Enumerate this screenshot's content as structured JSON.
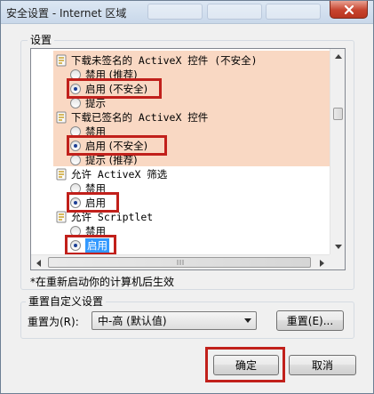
{
  "window": {
    "title": "安全设置 - Internet 区域"
  },
  "settings": {
    "group_label": "设置",
    "items": [
      {
        "kind": "header",
        "label": "下载未签名的 ActiveX 控件 (不安全)"
      },
      {
        "kind": "option",
        "label": "禁用 (推荐)",
        "selected": false
      },
      {
        "kind": "option",
        "label": "启用 (不安全)",
        "selected": true
      },
      {
        "kind": "option",
        "label": "提示",
        "selected": false
      },
      {
        "kind": "header",
        "label": "下载已签名的 ActiveX 控件"
      },
      {
        "kind": "option",
        "label": "禁用",
        "selected": false
      },
      {
        "kind": "option",
        "label": "启用 (不安全)",
        "selected": true
      },
      {
        "kind": "option",
        "label": "提示 (推荐)",
        "selected": false
      },
      {
        "kind": "header",
        "label": "允许 ActiveX 筛选"
      },
      {
        "kind": "option",
        "label": "禁用",
        "selected": false
      },
      {
        "kind": "option",
        "label": "启用",
        "selected": true
      },
      {
        "kind": "header",
        "label": "允许 Scriptlet"
      },
      {
        "kind": "option",
        "label": "禁用",
        "selected": false
      },
      {
        "kind": "option",
        "label": "启用",
        "selected": true
      }
    ],
    "restart_note": "*在重新启动你的计算机后生效"
  },
  "reset": {
    "group_label": "重置自定义设置",
    "reset_to_label": "重置为(R):",
    "select_value": "中-高 (默认值)",
    "reset_button": "重置(E)..."
  },
  "footer": {
    "ok_label": "确定",
    "cancel_label": "取消"
  },
  "colors": {
    "highlight": "#f9d8c3",
    "red_outline": "#c1201b",
    "selection": "#3399ff"
  }
}
